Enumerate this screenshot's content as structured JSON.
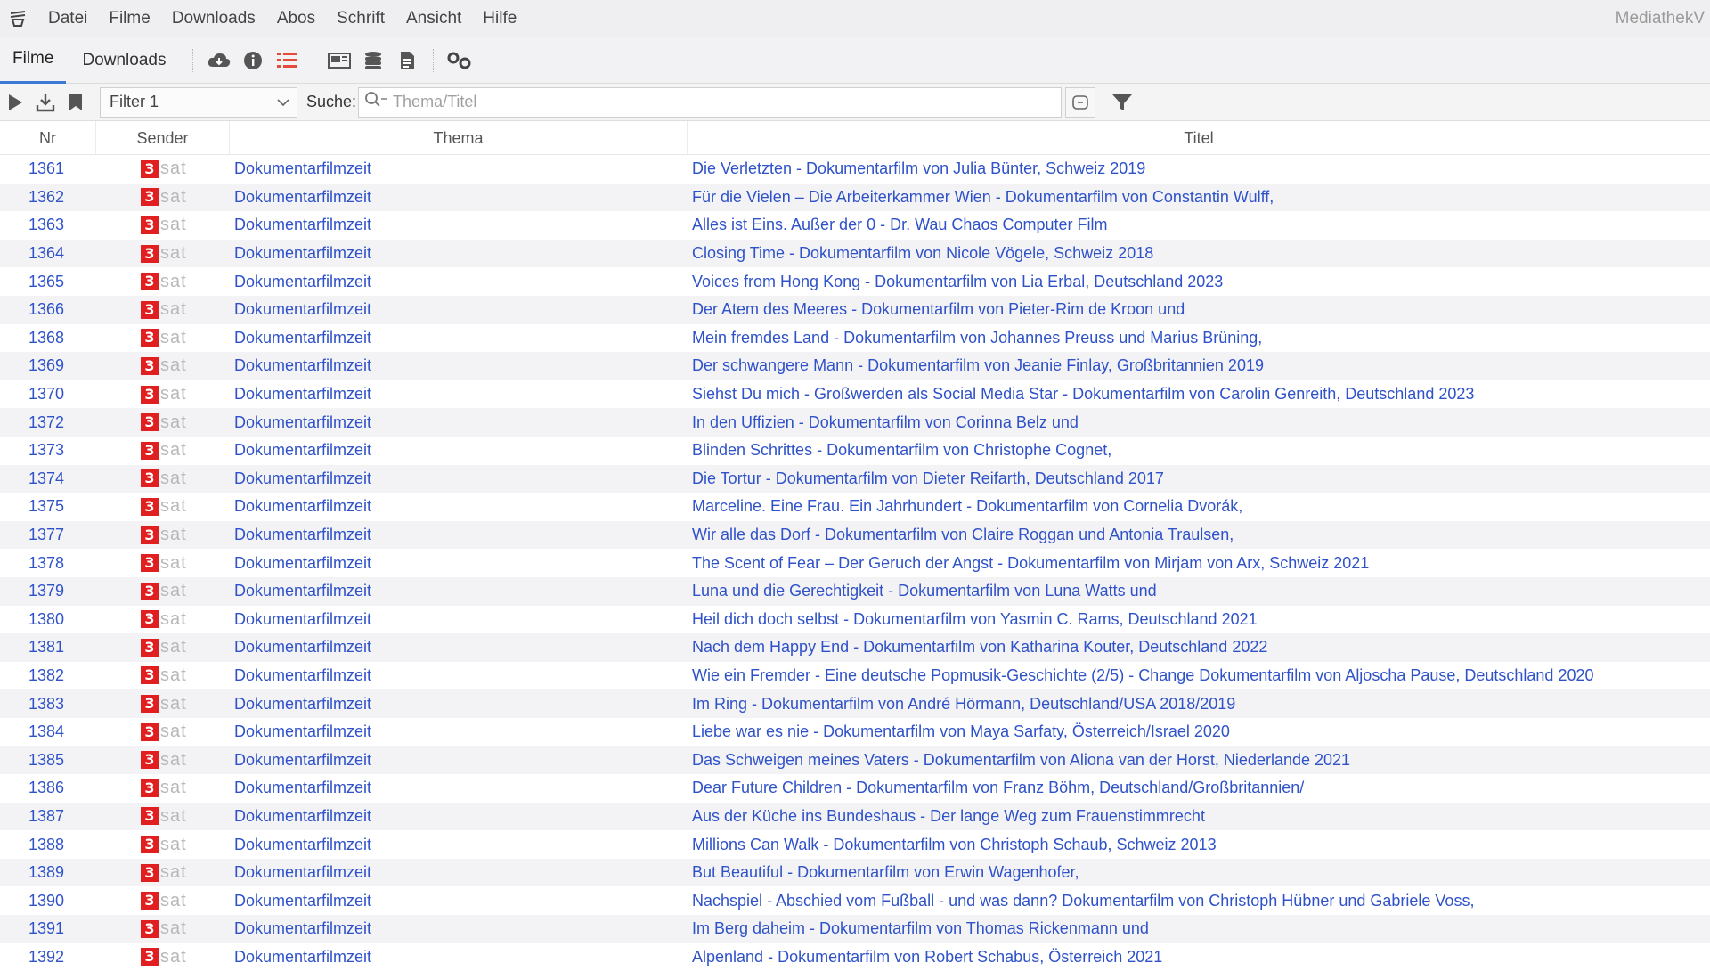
{
  "app_title": "MediathekV",
  "menu": [
    "Datei",
    "Filme",
    "Downloads",
    "Abos",
    "Schrift",
    "Ansicht",
    "Hilfe"
  ],
  "toolbar": {
    "tabs": [
      "Filme",
      "Downloads"
    ],
    "active_tab": "Filme",
    "icons": [
      "cloud-download-icon",
      "info-icon",
      "list-icon",
      "video-player-icon",
      "stack-icon",
      "document-icon",
      "settings-icon"
    ]
  },
  "filterbar": {
    "filter_value": "Filter 1",
    "search_label": "Suche:",
    "search_placeholder": "Thema/Titel"
  },
  "table": {
    "columns": [
      "Nr",
      "Sender",
      "Thema",
      "Titel"
    ],
    "sender_logo": {
      "number": "3",
      "text": "sat",
      "color": "#e02020"
    },
    "link_color": "#2f52c9",
    "rows": [
      {
        "nr": "1361",
        "thema": "Dokumentarfilmzeit",
        "titel": "Die Verletzten - Dokumentarfilm von Julia Bünter, Schweiz 2019"
      },
      {
        "nr": "1362",
        "thema": "Dokumentarfilmzeit",
        "titel": "Für die Vielen – Die Arbeiterkammer Wien - Dokumentarfilm von Constantin Wulff,"
      },
      {
        "nr": "1363",
        "thema": "Dokumentarfilmzeit",
        "titel": "Alles ist Eins. Außer der 0 - Dr. Wau Chaos Computer Film"
      },
      {
        "nr": "1364",
        "thema": "Dokumentarfilmzeit",
        "titel": "Closing Time - Dokumentarfilm von Nicole Vögele, Schweiz 2018"
      },
      {
        "nr": "1365",
        "thema": "Dokumentarfilmzeit",
        "titel": "Voices from Hong Kong - Dokumentarfilm von Lia Erbal, Deutschland 2023"
      },
      {
        "nr": "1366",
        "thema": "Dokumentarfilmzeit",
        "titel": "Der Atem des Meeres - Dokumentarfilm von Pieter-Rim de Kroon und"
      },
      {
        "nr": "1368",
        "thema": "Dokumentarfilmzeit",
        "titel": "Mein fremdes Land - Dokumentarfilm von Johannes Preuss und Marius Brüning,"
      },
      {
        "nr": "1369",
        "thema": "Dokumentarfilmzeit",
        "titel": "Der schwangere Mann - Dokumentarfilm von Jeanie Finlay, Großbritannien 2019"
      },
      {
        "nr": "1370",
        "thema": "Dokumentarfilmzeit",
        "titel": "Siehst Du mich - Großwerden als Social Media Star - Dokumentarfilm von Carolin Genreith, Deutschland 2023"
      },
      {
        "nr": "1372",
        "thema": "Dokumentarfilmzeit",
        "titel": "In den Uffizien - Dokumentarfilm von Corinna Belz und"
      },
      {
        "nr": "1373",
        "thema": "Dokumentarfilmzeit",
        "titel": "Blinden Schrittes - Dokumentarfilm von Christophe Cognet,"
      },
      {
        "nr": "1374",
        "thema": "Dokumentarfilmzeit",
        "titel": "Die Tortur - Dokumentarfilm von Dieter Reifarth, Deutschland 2017"
      },
      {
        "nr": "1375",
        "thema": "Dokumentarfilmzeit",
        "titel": "Marceline. Eine Frau. Ein Jahrhundert - Dokumentarfilm von Cornelia Dvorák,"
      },
      {
        "nr": "1377",
        "thema": "Dokumentarfilmzeit",
        "titel": "Wir alle das Dorf - Dokumentarfilm von Claire Roggan und Antonia Traulsen,"
      },
      {
        "nr": "1378",
        "thema": "Dokumentarfilmzeit",
        "titel": "The Scent of Fear – Der Geruch der Angst - Dokumentarfilm von Mirjam von Arx, Schweiz 2021"
      },
      {
        "nr": "1379",
        "thema": "Dokumentarfilmzeit",
        "titel": "Luna und die Gerechtigkeit - Dokumentarfilm von Luna Watts und"
      },
      {
        "nr": "1380",
        "thema": "Dokumentarfilmzeit",
        "titel": "Heil dich doch selbst - Dokumentarfilm von Yasmin C. Rams, Deutschland 2021"
      },
      {
        "nr": "1381",
        "thema": "Dokumentarfilmzeit",
        "titel": "Nach dem Happy End - Dokumentarfilm von Katharina Kouter, Deutschland 2022"
      },
      {
        "nr": "1382",
        "thema": "Dokumentarfilmzeit",
        "titel": "Wie ein Fremder - Eine deutsche Popmusik-Geschichte (2/5) - Change Dokumentarfilm von Aljoscha Pause, Deutschland 2020"
      },
      {
        "nr": "1383",
        "thema": "Dokumentarfilmzeit",
        "titel": "Im Ring - Dokumentarfilm von André Hörmann, Deutschland/USA 2018/2019"
      },
      {
        "nr": "1384",
        "thema": "Dokumentarfilmzeit",
        "titel": "Liebe war es nie - Dokumentarfilm von Maya Sarfaty, Österreich/Israel 2020"
      },
      {
        "nr": "1385",
        "thema": "Dokumentarfilmzeit",
        "titel": "Das Schweigen meines Vaters - Dokumentarfilm von Aliona van der Horst, Niederlande 2021"
      },
      {
        "nr": "1386",
        "thema": "Dokumentarfilmzeit",
        "titel": "Dear Future Children - Dokumentarfilm von Franz Böhm, Deutschland/Großbritannien/"
      },
      {
        "nr": "1387",
        "thema": "Dokumentarfilmzeit",
        "titel": "Aus der Küche ins Bundeshaus - Der lange Weg zum Frauenstimmrecht"
      },
      {
        "nr": "1388",
        "thema": "Dokumentarfilmzeit",
        "titel": "Millions Can Walk - Dokumentarfilm von Christoph Schaub, Schweiz 2013"
      },
      {
        "nr": "1389",
        "thema": "Dokumentarfilmzeit",
        "titel": "But Beautiful - Dokumentarfilm von Erwin Wagenhofer,"
      },
      {
        "nr": "1390",
        "thema": "Dokumentarfilmzeit",
        "titel": "Nachspiel - Abschied vom Fußball - und was dann? Dokumentarfilm von Christoph Hübner und Gabriele Voss,"
      },
      {
        "nr": "1391",
        "thema": "Dokumentarfilmzeit",
        "titel": "Im Berg daheim - Dokumentarfilm von Thomas Rickenmann und"
      },
      {
        "nr": "1392",
        "thema": "Dokumentarfilmzeit",
        "titel": "Alpenland - Dokumentarfilm von Robert Schabus, Österreich 2021"
      }
    ]
  }
}
